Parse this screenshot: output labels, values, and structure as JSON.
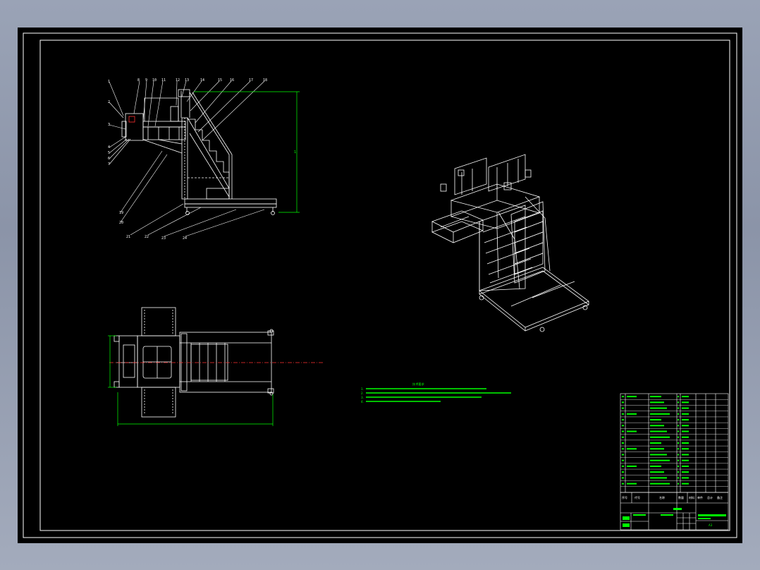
{
  "colors": {
    "background": "#000000",
    "line": "#ffffff",
    "dimension": "#00ff00",
    "centerline": "#ff3030",
    "outer": "#9aa3b6"
  },
  "views": {
    "front_view": {
      "balloons": [
        "1",
        "2",
        "3",
        "4",
        "5",
        "6",
        "7",
        "8",
        "9",
        "10",
        "11",
        "12",
        "13",
        "14",
        "15",
        "16",
        "17",
        "18",
        "19",
        "20",
        "21",
        "22"
      ]
    },
    "top_view": {},
    "isometric_view": {}
  },
  "notes": {
    "title": "技术要求",
    "lines": [
      "1.",
      "2.",
      "3.",
      "4."
    ]
  },
  "title_block": {
    "bom_rows": 17,
    "header": [
      "序号",
      "代号",
      "名称",
      "数量",
      "材料",
      "单件",
      "总计",
      "备注"
    ],
    "drawing_number": "",
    "sheet": "A3"
  }
}
